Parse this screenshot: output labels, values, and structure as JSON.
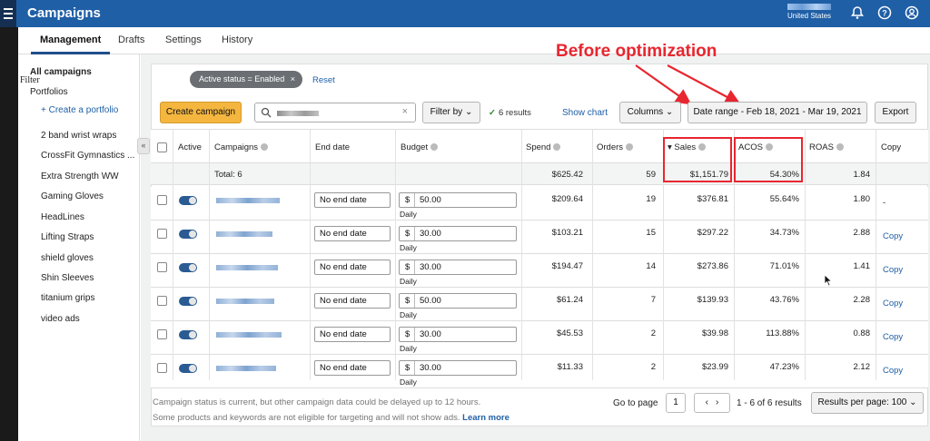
{
  "header": {
    "title": "Campaigns",
    "country": "United States"
  },
  "tabs": [
    "Management",
    "Drafts",
    "Settings",
    "History"
  ],
  "sidebar": {
    "all": "All campaigns",
    "portfolios": "Portfolios",
    "create": "+ Create a portfolio",
    "items": [
      "2 band wrist wraps",
      "CrossFit Gymnastics ...",
      "Extra Strength WW",
      "Gaming Gloves",
      "HeadLines",
      "Lifting Straps",
      "shield gloves",
      "Shin Sleeves",
      "titanium grips",
      "video ads"
    ]
  },
  "filter": {
    "label": "Filter",
    "chip": "Active status = Enabled",
    "chip_close": "×",
    "reset": "Reset"
  },
  "annotation": "Before optimization",
  "toolbar": {
    "create": "Create campaign",
    "clear": "×",
    "filter_by": "Filter by",
    "results": "6 results",
    "show_chart": "Show chart",
    "columns": "Columns",
    "date_range": "Date range - Feb 18, 2021 - Mar 19, 2021",
    "export": "Export"
  },
  "columns": {
    "active": "Active",
    "campaigns": "Campaigns",
    "end_date": "End date",
    "budget": "Budget",
    "spend": "Spend",
    "orders": "Orders",
    "sales": "Sales",
    "acos": "ACOS",
    "roas": "ROAS",
    "copy": "Copy"
  },
  "total": {
    "label": "Total: 6",
    "spend": "$625.42",
    "orders": "59",
    "sales": "$1,151.79",
    "acos": "54.30%",
    "roas": "1.84"
  },
  "rows": [
    {
      "end_date": "No end date",
      "currency": "$",
      "budget": "50.00",
      "budget_type": "Daily",
      "spend": "$209.64",
      "orders": "19",
      "sales": "$376.81",
      "acos": "55.64%",
      "roas": "1.80",
      "copy": "-"
    },
    {
      "end_date": "No end date",
      "currency": "$",
      "budget": "30.00",
      "budget_type": "Daily",
      "spend": "$103.21",
      "orders": "15",
      "sales": "$297.22",
      "acos": "34.73%",
      "roas": "2.88",
      "copy": "Copy"
    },
    {
      "end_date": "No end date",
      "currency": "$",
      "budget": "30.00",
      "budget_type": "Daily",
      "spend": "$194.47",
      "orders": "14",
      "sales": "$273.86",
      "acos": "71.01%",
      "roas": "1.41",
      "copy": "Copy"
    },
    {
      "end_date": "No end date",
      "currency": "$",
      "budget": "50.00",
      "budget_type": "Daily",
      "spend": "$61.24",
      "orders": "7",
      "sales": "$139.93",
      "acos": "43.76%",
      "roas": "2.28",
      "copy": "Copy"
    },
    {
      "end_date": "No end date",
      "currency": "$",
      "budget": "30.00",
      "budget_type": "Daily",
      "spend": "$45.53",
      "orders": "2",
      "sales": "$39.98",
      "acos": "113.88%",
      "roas": "0.88",
      "copy": "Copy"
    },
    {
      "end_date": "No end date",
      "currency": "$",
      "budget": "30.00",
      "budget_type": "Daily",
      "spend": "$11.33",
      "orders": "2",
      "sales": "$23.99",
      "acos": "47.23%",
      "roas": "2.12",
      "copy": "Copy"
    }
  ],
  "footer": {
    "note1": "Campaign status is current, but other campaign data could be delayed up to 12 hours.",
    "note2": "Some products and keywords are not eligible for targeting and will not show ads.",
    "learn_more": "Learn more",
    "go_to_page": "Go to page",
    "page": "1",
    "prev": "‹",
    "next": "›",
    "range": "1 - 6 of 6 results",
    "per_page": "Results per page: 100"
  }
}
